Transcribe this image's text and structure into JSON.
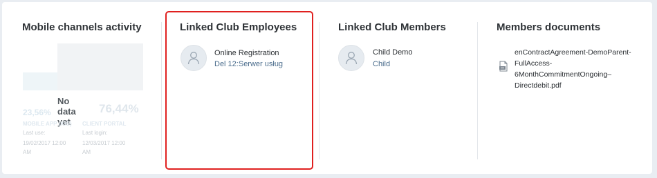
{
  "mobile": {
    "title": "Mobile channels activity",
    "no_data": "No data yet",
    "app_percent": "23,56%",
    "portal_percent": "76,44%",
    "app_label": "MOBILE APP (IOS)",
    "portal_label": "CLIENT PORTAL",
    "app_last_use_label": "Last use:",
    "app_last_use_value": "19/02/2017 12:00",
    "app_last_use_ampm": "AM",
    "portal_last_login_label": "Last login:",
    "portal_last_login_value": "12/03/2017 12:00",
    "portal_last_login_ampm": "AM"
  },
  "employees": {
    "title": "Linked Club Employees",
    "items": [
      {
        "name": "Online Registration",
        "detail": "Del 12:Serwer usług",
        "icon": "user-avatar-icon"
      }
    ]
  },
  "members": {
    "title": "Linked Club Members",
    "items": [
      {
        "name": "Child Demo",
        "detail": "Child",
        "icon": "user-avatar-icon"
      }
    ]
  },
  "documents": {
    "title": "Members documents",
    "items": [
      {
        "name": "enContractAgreement-DemoParent-FullAccess-6MonthCommitmentOngoing–Directdebit.pdf",
        "icon": "pdf-file-icon"
      }
    ]
  },
  "colors": {
    "highlight": "#e0201f",
    "link_blue": "#4a6c8c",
    "card_bg": "#ffffff",
    "page_bg": "#e9edf2"
  }
}
